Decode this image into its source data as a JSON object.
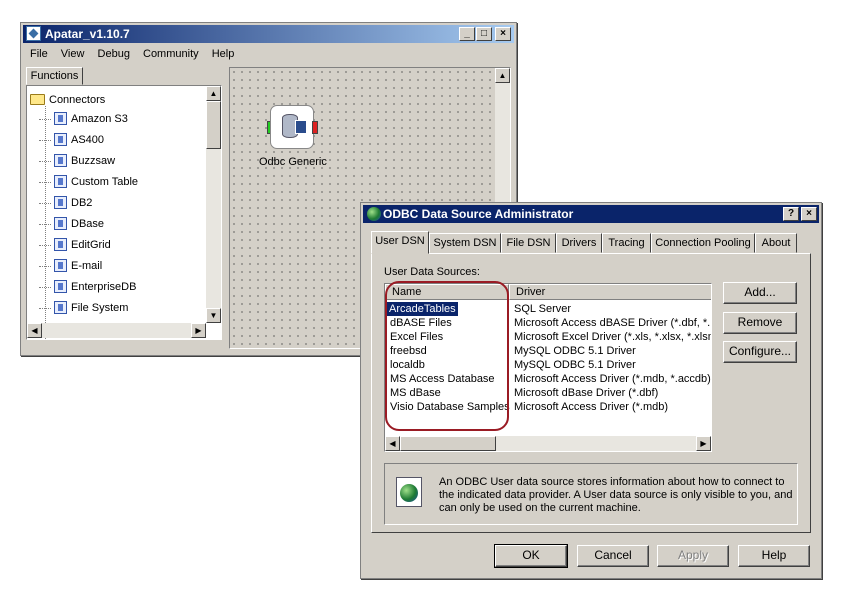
{
  "apatar": {
    "title": "Apatar_v1.10.7",
    "window_buttons": {
      "minimize": "_",
      "maximize": "□",
      "close": "×"
    },
    "menu": [
      "File",
      "View",
      "Debug",
      "Community",
      "Help"
    ],
    "panel_tab": "Functions",
    "tree": {
      "root": "Connectors",
      "items": [
        {
          "label": "Amazon S3",
          "icon": "amazon-s3-icon"
        },
        {
          "label": "AS400",
          "icon": "as400-icon"
        },
        {
          "label": "Buzzsaw",
          "icon": "buzzsaw-icon"
        },
        {
          "label": "Custom Table",
          "icon": "custom-table-icon"
        },
        {
          "label": "DB2",
          "icon": "db2-icon"
        },
        {
          "label": "DBase",
          "icon": "dbase-icon"
        },
        {
          "label": "EditGrid",
          "icon": "editgrid-icon"
        },
        {
          "label": "E-mail",
          "icon": "email-icon"
        },
        {
          "label": "EnterpriseDB",
          "icon": "enterprisedb-icon"
        },
        {
          "label": "File System",
          "icon": "file-system-icon"
        }
      ]
    },
    "canvas_node": {
      "label": "Odbc Generic"
    }
  },
  "odbc": {
    "title": "ODBC Data Source Administrator",
    "title_buttons": {
      "help": "?",
      "close": "×"
    },
    "tabs": [
      "User DSN",
      "System DSN",
      "File DSN",
      "Drivers",
      "Tracing",
      "Connection Pooling",
      "About"
    ],
    "active_tab": "User DSN",
    "list_label": "User Data Sources:",
    "columns": {
      "name": "Name",
      "driver": "Driver"
    },
    "rows": [
      {
        "name": "ArcadeTables",
        "driver": "SQL Server",
        "selected": true
      },
      {
        "name": "dBASE Files",
        "driver": "Microsoft Access dBASE Driver (*.dbf, *.n"
      },
      {
        "name": "Excel Files",
        "driver": "Microsoft Excel Driver (*.xls, *.xlsx, *.xlsm,"
      },
      {
        "name": "freebsd",
        "driver": "MySQL ODBC 5.1 Driver"
      },
      {
        "name": "localdb",
        "driver": "MySQL ODBC 5.1 Driver"
      },
      {
        "name": "MS Access Database",
        "driver": "Microsoft Access Driver (*.mdb, *.accdb)"
      },
      {
        "name": "MS dBase",
        "driver": "Microsoft dBase Driver (*.dbf)"
      },
      {
        "name": "Visio Database Samples",
        "driver": "Microsoft Access Driver (*.mdb)"
      }
    ],
    "side_buttons": {
      "add": "Add...",
      "remove": "Remove",
      "configure": "Configure..."
    },
    "info_text": "An ODBC User data source stores information about how to connect to the indicated data provider.   A User data source is only visible to you, and can only be used on the current machine.",
    "bottom_buttons": {
      "ok": "OK",
      "cancel": "Cancel",
      "apply": "Apply",
      "help": "Help"
    },
    "colors": {
      "title_bar": "#0a246a",
      "selection": "#0a246a",
      "highlight_oval": "#9a1b24"
    }
  }
}
